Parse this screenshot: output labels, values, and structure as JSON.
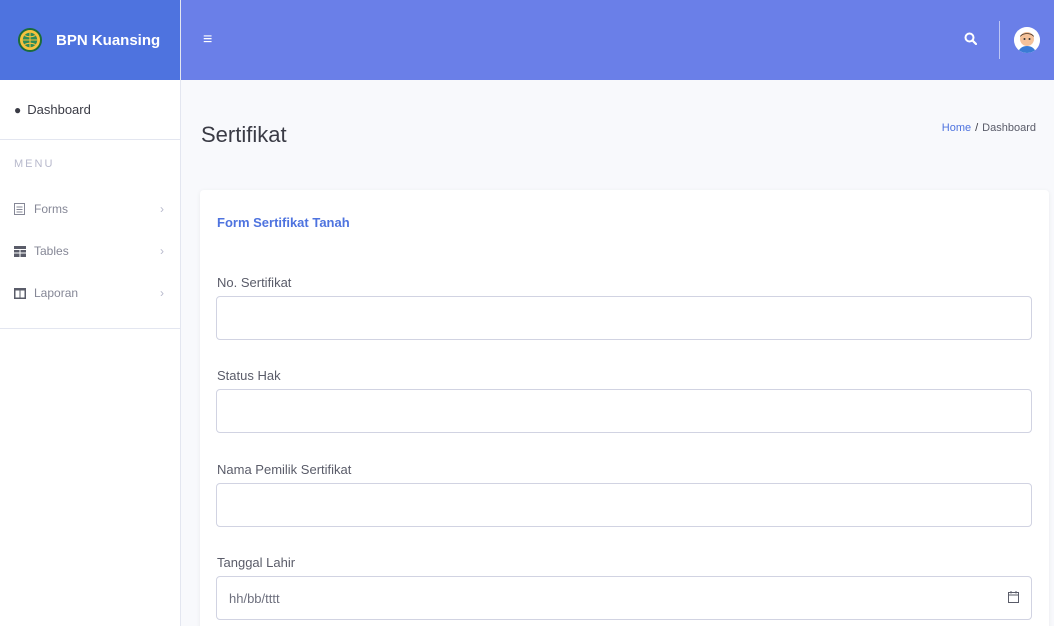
{
  "brand": {
    "name": "BPN Kuansing"
  },
  "sidebar": {
    "dashboard_label": "Dashboard",
    "menu_heading": "MENU",
    "items": [
      {
        "label": "Forms",
        "icon": "form-icon"
      },
      {
        "label": "Tables",
        "icon": "table-icon"
      },
      {
        "label": "Laporan",
        "icon": "columns-icon"
      }
    ]
  },
  "topbar": {
    "menu_icon": "hamburger-icon",
    "search_icon": "search-icon",
    "avatar": "user-avatar"
  },
  "page": {
    "title": "Sertifikat",
    "breadcrumb": {
      "home": "Home",
      "separator": "/",
      "current": "Dashboard"
    }
  },
  "form": {
    "title": "Form Sertifikat Tanah",
    "fields": [
      {
        "label": "No. Sertifikat",
        "value": ""
      },
      {
        "label": "Status Hak",
        "value": ""
      },
      {
        "label": "Nama Pemilik Sertifikat",
        "value": ""
      },
      {
        "label": "Tanggal Lahir",
        "placeholder": "hh/bb/tttt"
      }
    ]
  },
  "colors": {
    "primary": "#4e73df",
    "topbar": "#6a7fe8",
    "background": "#f8f9fc"
  }
}
